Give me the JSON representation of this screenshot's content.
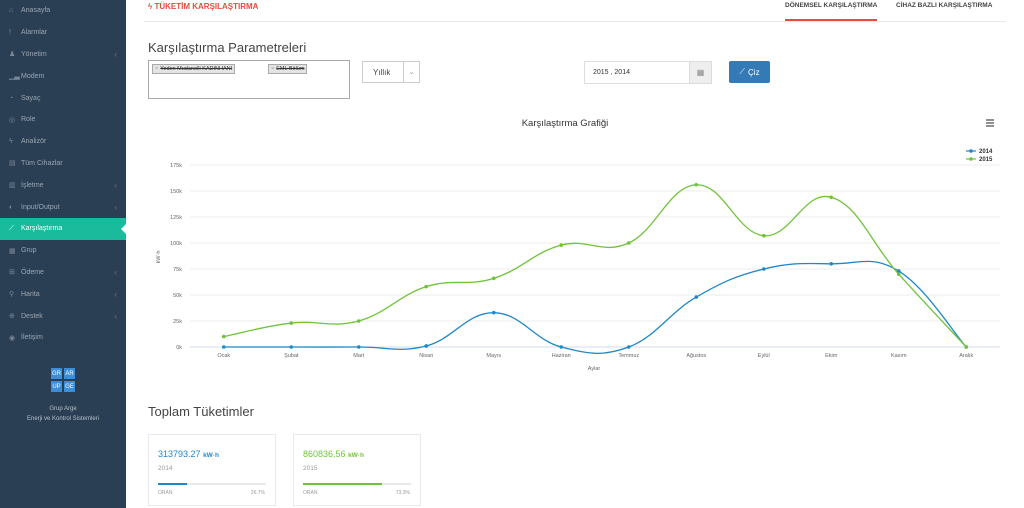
{
  "sidebar": {
    "items": [
      {
        "label": "Anasayfa",
        "icon": "home-icon",
        "glyph": "⌂",
        "chevron": false
      },
      {
        "label": "Alarmlar",
        "icon": "alert-icon",
        "glyph": "!",
        "chevron": false
      },
      {
        "label": "Yönetim",
        "icon": "users-icon",
        "glyph": "♟",
        "chevron": true
      },
      {
        "label": "Modem",
        "icon": "signal-icon",
        "glyph": "▁▃",
        "chevron": false
      },
      {
        "label": "Sayaç",
        "icon": "meter-icon",
        "glyph": "◔",
        "chevron": false
      },
      {
        "label": "Role",
        "icon": "relay-icon",
        "glyph": "◎",
        "chevron": false
      },
      {
        "label": "Analizör",
        "icon": "bolt-icon",
        "glyph": "ϟ",
        "chevron": false
      },
      {
        "label": "Tüm Cihazlar",
        "icon": "devices-icon",
        "glyph": "▤",
        "chevron": false
      },
      {
        "label": "İşletme",
        "icon": "building-icon",
        "glyph": "▥",
        "chevron": true
      },
      {
        "label": "Input/Output",
        "icon": "toggle-icon",
        "glyph": "◐",
        "chevron": true
      },
      {
        "label": "Karşılaştırma",
        "icon": "line-chart-icon",
        "glyph": "⟋",
        "chevron": false,
        "active": true
      },
      {
        "label": "Grup",
        "icon": "grid-icon",
        "glyph": "▦",
        "chevron": false
      },
      {
        "label": "Ödeme",
        "icon": "cart-icon",
        "glyph": "⊞",
        "chevron": true
      },
      {
        "label": "Harita",
        "icon": "map-pin-icon",
        "glyph": "⚲",
        "chevron": true
      },
      {
        "label": "Destek",
        "icon": "support-icon",
        "glyph": "⊕",
        "chevron": true
      },
      {
        "label": "İletişim",
        "icon": "contact-icon",
        "glyph": "◉",
        "chevron": false
      }
    ],
    "logo_letters": [
      "GR",
      "AR",
      "UP",
      "GE"
    ],
    "brand_name": "Grup Arge",
    "brand_tagline": "Enerji ve Kontrol Sistemleri"
  },
  "header": {
    "title": "TÜKETİM KARŞILAŞTIRMA",
    "tabs": [
      "DÖNEMSEL KARŞILAŞTIRMA",
      "CİHAZ BAZLI KARŞILAŞTIRMA"
    ]
  },
  "params": {
    "heading": "Karşılaştırma Parametreleri",
    "tags": [
      "Yoden Mudanolli KADINHANI",
      "EML Bölüm"
    ],
    "period": "Yıllık",
    "date_range": "2015 , 2014",
    "draw_label": "Çiz"
  },
  "chart_data": {
    "type": "line",
    "title": "Karşılaştırma Grafiği",
    "xlabel": "Aylar",
    "ylabel": "kW·h",
    "categories": [
      "Ocak",
      "Şubat",
      "Mart",
      "Nisan",
      "Mayıs",
      "Haziran",
      "Temmuz",
      "Ağustos",
      "Eylül",
      "Ekim",
      "Kasım",
      "Aralık"
    ],
    "y_ticks": [
      "0k",
      "25k",
      "50k",
      "75k",
      "100k",
      "125k",
      "150k",
      "175k"
    ],
    "ylim": [
      0,
      175000
    ],
    "series": [
      {
        "name": "2014",
        "color": "#1e88c9",
        "values": [
          0,
          0,
          0,
          1000,
          33000,
          0,
          0,
          48000,
          75000,
          80000,
          73000,
          0
        ]
      },
      {
        "name": "2015",
        "color": "#6fc33b",
        "values": [
          10000,
          23000,
          25000,
          58000,
          66000,
          98000,
          100000,
          156000,
          107000,
          144000,
          70000,
          0
        ]
      }
    ],
    "legend": "top-right",
    "grid": true
  },
  "totals": {
    "heading": "Toplam Tüketimler",
    "unit": "kW·h",
    "oran_label": "ORAN",
    "cards": [
      {
        "value": "313793.27",
        "year": "2014",
        "percent_text": "26.7%",
        "ratio": 0.267,
        "color": "#1e88c9"
      },
      {
        "value": "860836.56",
        "year": "2015",
        "percent_text": "73.3%",
        "ratio": 0.733,
        "color": "#6fc33b"
      }
    ]
  }
}
